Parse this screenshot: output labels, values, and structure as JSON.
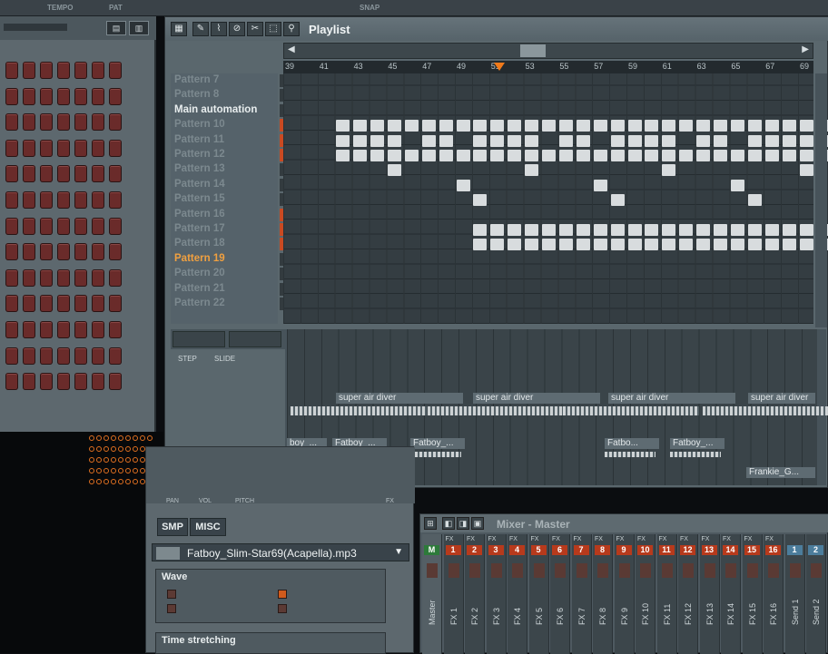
{
  "background": {
    "top_labels": [
      "TEMPO",
      "PAT",
      "SNAP"
    ]
  },
  "playlist": {
    "title": "Playlist",
    "ruler": [
      "39",
      "41",
      "43",
      "45",
      "47",
      "49",
      "51",
      "53",
      "55",
      "57",
      "59",
      "61",
      "63",
      "65",
      "67",
      "69"
    ],
    "patterns": [
      {
        "label": "Pattern 7",
        "state": "inactive"
      },
      {
        "label": "Pattern 8",
        "state": "inactive"
      },
      {
        "label": "Main automation",
        "state": "active"
      },
      {
        "label": "Pattern 10",
        "state": "inactive"
      },
      {
        "label": "Pattern 11",
        "state": "inactive"
      },
      {
        "label": "Pattern 12",
        "state": "inactive"
      },
      {
        "label": "Pattern 13",
        "state": "inactive"
      },
      {
        "label": "Pattern 14",
        "state": "inactive"
      },
      {
        "label": "Pattern 15",
        "state": "inactive"
      },
      {
        "label": "Pattern 16",
        "state": "inactive"
      },
      {
        "label": "Pattern 17",
        "state": "inactive"
      },
      {
        "label": "Pattern 18",
        "state": "inactive"
      },
      {
        "label": "Pattern 19",
        "state": "selected"
      },
      {
        "label": "Pattern 20",
        "state": "inactive"
      },
      {
        "label": "Pattern 21",
        "state": "inactive"
      },
      {
        "label": "Pattern 22",
        "state": "inactive"
      }
    ],
    "automation": {
      "step_label": "STEP",
      "slide_label": "SLIDE",
      "clips_row1": [
        "super air diver",
        "super air diver",
        "super air diver",
        "super air diver"
      ],
      "clips_row2": [
        "Fatboy_...",
        "Fatboy_...",
        "Fatbo...",
        "Fatboy_...",
        "Fatboy_..."
      ],
      "clip_row2_first": "boy_...",
      "clip_bottom": "Frankie_G..."
    }
  },
  "sampler": {
    "tabs": [
      "SMP",
      "MISC"
    ],
    "header_labels": [
      "PAN",
      "VOL",
      "PITCH",
      "FX"
    ],
    "file": "Fatboy_Slim-Star69(Acapella).mp3",
    "sections": [
      {
        "title": "Wave"
      },
      {
        "title": "Time stretching"
      }
    ]
  },
  "mixer": {
    "title": "Mixer - Master",
    "tracks": [
      {
        "top": "",
        "num": "M",
        "name": "Master",
        "kind": "master"
      },
      {
        "top": "FX",
        "num": "1",
        "name": "FX 1",
        "kind": "fx"
      },
      {
        "top": "FX",
        "num": "2",
        "name": "FX 2",
        "kind": "fx"
      },
      {
        "top": "FX",
        "num": "3",
        "name": "FX 3",
        "kind": "fx"
      },
      {
        "top": "FX",
        "num": "4",
        "name": "FX 4",
        "kind": "fx"
      },
      {
        "top": "FX",
        "num": "5",
        "name": "FX 5",
        "kind": "fx"
      },
      {
        "top": "FX",
        "num": "6",
        "name": "FX 6",
        "kind": "fx"
      },
      {
        "top": "FX",
        "num": "7",
        "name": "FX 7",
        "kind": "fx"
      },
      {
        "top": "FX",
        "num": "8",
        "name": "FX 8",
        "kind": "fx"
      },
      {
        "top": "FX",
        "num": "9",
        "name": "FX 9",
        "kind": "fx"
      },
      {
        "top": "FX",
        "num": "10",
        "name": "FX 10",
        "kind": "fx"
      },
      {
        "top": "FX",
        "num": "11",
        "name": "FX 11",
        "kind": "fx"
      },
      {
        "top": "FX",
        "num": "12",
        "name": "FX 12",
        "kind": "fx"
      },
      {
        "top": "FX",
        "num": "13",
        "name": "FX 13",
        "kind": "fx"
      },
      {
        "top": "FX",
        "num": "14",
        "name": "FX 14",
        "kind": "fx"
      },
      {
        "top": "FX",
        "num": "15",
        "name": "FX 15",
        "kind": "fx"
      },
      {
        "top": "FX",
        "num": "16",
        "name": "FX 16",
        "kind": "fx"
      },
      {
        "top": "",
        "num": "1",
        "name": "Send 1",
        "kind": "send"
      },
      {
        "top": "",
        "num": "2",
        "name": "Send 2",
        "kind": "send"
      }
    ]
  },
  "colors": {
    "accent": "#f07a1a",
    "pattern_block": "#d8dcde",
    "step_button": "#6a2b2a"
  }
}
